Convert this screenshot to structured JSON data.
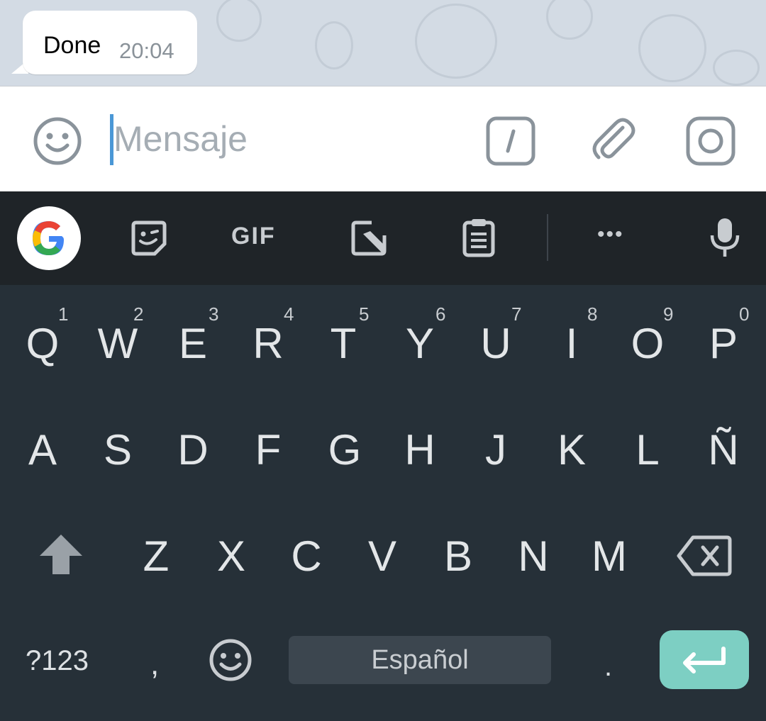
{
  "chat": {
    "message": {
      "text": "Done",
      "time": "20:04"
    }
  },
  "composer": {
    "placeholder": "Mensaje",
    "icons": [
      "emoji-icon",
      "slash-command-icon",
      "attach-icon",
      "camera-icon"
    ]
  },
  "keyboard_toolbar": {
    "items": [
      "google-icon",
      "sticker-icon",
      "gif-button",
      "stylus-icon",
      "clipboard-icon",
      "more-icon",
      "mic-icon"
    ],
    "gif_label": "GIF",
    "more_label": "•••"
  },
  "keyboard": {
    "row1": [
      {
        "key": "Q",
        "hint": "1"
      },
      {
        "key": "W",
        "hint": "2"
      },
      {
        "key": "E",
        "hint": "3"
      },
      {
        "key": "R",
        "hint": "4"
      },
      {
        "key": "T",
        "hint": "5"
      },
      {
        "key": "Y",
        "hint": "6"
      },
      {
        "key": "U",
        "hint": "7"
      },
      {
        "key": "I",
        "hint": "8"
      },
      {
        "key": "O",
        "hint": "9"
      },
      {
        "key": "P",
        "hint": "0"
      }
    ],
    "row2": [
      "A",
      "S",
      "D",
      "F",
      "G",
      "H",
      "J",
      "K",
      "L",
      "Ñ"
    ],
    "row3": [
      "Z",
      "X",
      "C",
      "V",
      "B",
      "N",
      "M"
    ],
    "symbols_label": "?123",
    "comma_label": ",",
    "period_label": ".",
    "space_label": "Español",
    "colors": {
      "background": "#263038",
      "toolbar": "#1f2428",
      "enter": "#7dcfc3",
      "key_text": "#e3e6e8"
    }
  }
}
